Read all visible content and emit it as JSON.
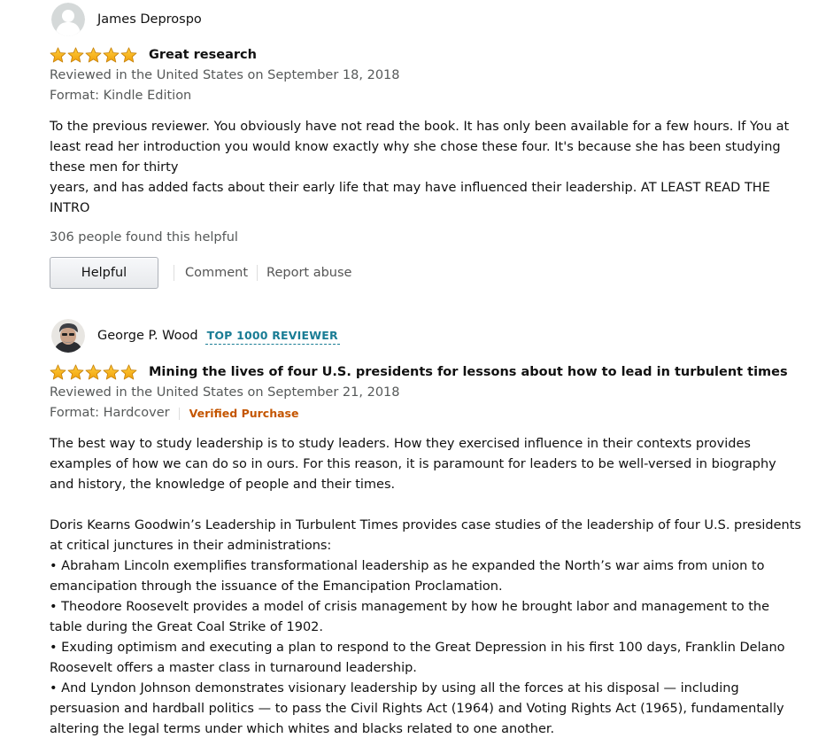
{
  "star_color": "#f4a41b",
  "reviews": [
    {
      "reviewer": "James Deprospo",
      "avatar_icon": "default-user-icon",
      "badge": "",
      "rating": 5,
      "title": "Great research",
      "reviewed_in": "Reviewed in the United States on September 18, 2018",
      "format": "Format: Kindle Edition",
      "verified": "",
      "body": [
        "To the previous reviewer. You obviously have not read the book. It has only been available for a few hours. If You at least read her introduction you would know exactly why she chose these four. It's because she has been studying these men for thirty",
        "years, and has added facts about their early life that may have influenced their leadership. AT LEAST READ THE INTRO"
      ],
      "helpful_count": "306 people found this helpful",
      "actions": {
        "helpful": "Helpful",
        "comment": "Comment",
        "report": "Report abuse"
      }
    },
    {
      "reviewer": "George P. Wood",
      "avatar_icon": "photo-avatar-icon",
      "badge": "TOP 1000 REVIEWER",
      "rating": 5,
      "title": "Mining the lives of four U.S. presidents for lessons about how to lead in turbulent times",
      "reviewed_in": "Reviewed in the United States on September 21, 2018",
      "format": "Format: Hardcover",
      "verified": "Verified Purchase",
      "body": [
        "The best way to study leadership is to study leaders. How they exercised influence in their contexts provides examples of how we can do so in ours. For this reason, it is paramount for leaders to be well-versed in biography and history, the knowledge of people and their times.",
        "",
        "Doris Kearns Goodwin’s Leadership in Turbulent Times provides case studies of the leadership of four U.S. presidents at critical junctures in their administrations:",
        "• Abraham Lincoln exemplifies transformational leadership as he expanded the North’s war aims from union to emancipation through the issuance of the Emancipation Proclamation.",
        "• Theodore Roosevelt provides a model of crisis management by how he brought labor and management to the table during the Great Coal Strike of 1902.",
        "• Exuding optimism and executing a plan to respond to the Great Depression in his first 100 days, Franklin Delano Roosevelt offers a master class in turnaround leadership.",
        "• And Lyndon Johnson demonstrates visionary leadership by using all the forces at his disposal — including persuasion and hardball politics — to pass the Civil Rights Act (1964) and Voting Rights Act (1965), fundamentally altering the legal terms under which whites and blacks related to one another."
      ]
    }
  ]
}
